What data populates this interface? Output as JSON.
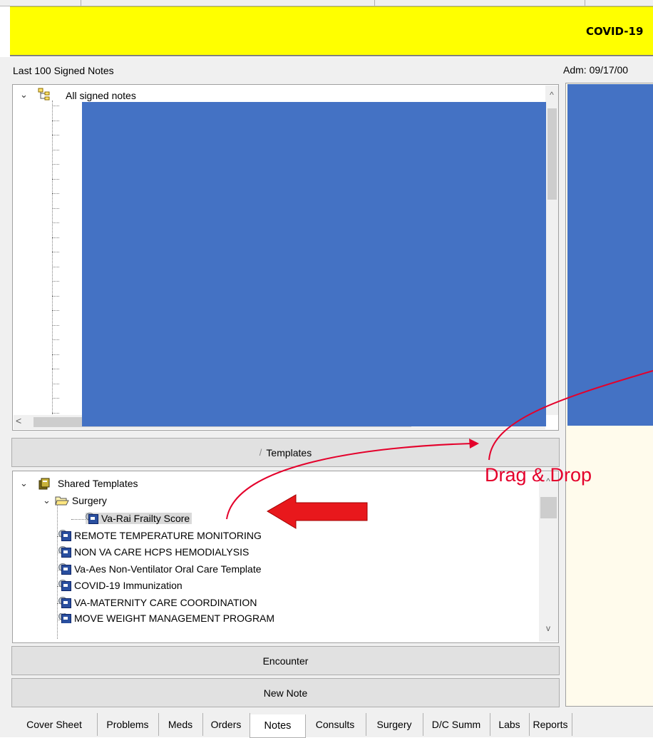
{
  "banner": {
    "title": "COVID-19",
    "color": "#ffff00"
  },
  "left_panel": {
    "label": "Last 100 Signed Notes"
  },
  "right_panel": {
    "adm_label": "Adm: 09/17/00"
  },
  "notes_tree": {
    "root_label": "All signed notes",
    "mask_color": "#4472c4",
    "scroll_left_glyph": "<",
    "scroll_right_glyph": ">",
    "scroll_up_glyph": "^"
  },
  "templates_button": {
    "label": "Templates",
    "sort_glyph": "/"
  },
  "templates_tree": {
    "root_label": "Shared Templates",
    "folder_label": "Surgery",
    "items": [
      {
        "label": "Va-Rai Frailty Score",
        "selected": true
      },
      {
        "label": "REMOTE TEMPERATURE MONITORING"
      },
      {
        "label": "NON VA CARE HCPS HEMODIALYSIS"
      },
      {
        "label": "Va-Aes Non-Ventilator Oral Care Template"
      },
      {
        "label": "COVID-19 Immunization"
      },
      {
        "label": "VA-MATERNITY CARE COORDINATION"
      },
      {
        "label": "MOVE WEIGHT MANAGEMENT PROGRAM"
      }
    ],
    "scroll_up_glyph": "^",
    "scroll_down_glyph": "v"
  },
  "encounter_button": {
    "label": "Encounter"
  },
  "new_note_button": {
    "label": "New Note"
  },
  "annotation": {
    "text": "Drag & Drop",
    "color": "#e4002b"
  },
  "tabs": [
    {
      "label": "Cover Sheet"
    },
    {
      "label": "Problems"
    },
    {
      "label": "Meds"
    },
    {
      "label": "Orders"
    },
    {
      "label": "Notes",
      "active": true
    },
    {
      "label": "Consults"
    },
    {
      "label": "Surgery"
    },
    {
      "label": "D/C Summ"
    },
    {
      "label": "Labs"
    },
    {
      "label": "Reports"
    }
  ]
}
